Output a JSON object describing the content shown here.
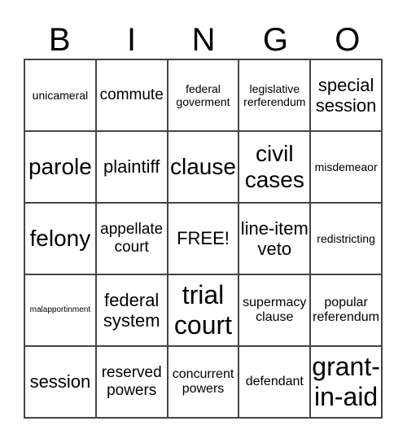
{
  "header": {
    "letters": [
      "B",
      "I",
      "N",
      "G",
      "O"
    ]
  },
  "cells": [
    [
      "unicameral",
      "commute",
      "federal goverment",
      "legislative rerferendum",
      "special session"
    ],
    [
      "parole",
      "plaintiff",
      "clause",
      "civil cases",
      "misdemeaor"
    ],
    [
      "felony",
      "appellate court",
      "FREE!",
      "line-item veto",
      "redistricting"
    ],
    [
      "malapportinment",
      "federal system",
      "trial court",
      "supermacy clause",
      "popular referendum"
    ],
    [
      "session",
      "reserved powers",
      "concurrent powers",
      "defendant",
      "grant-in-aid"
    ]
  ]
}
